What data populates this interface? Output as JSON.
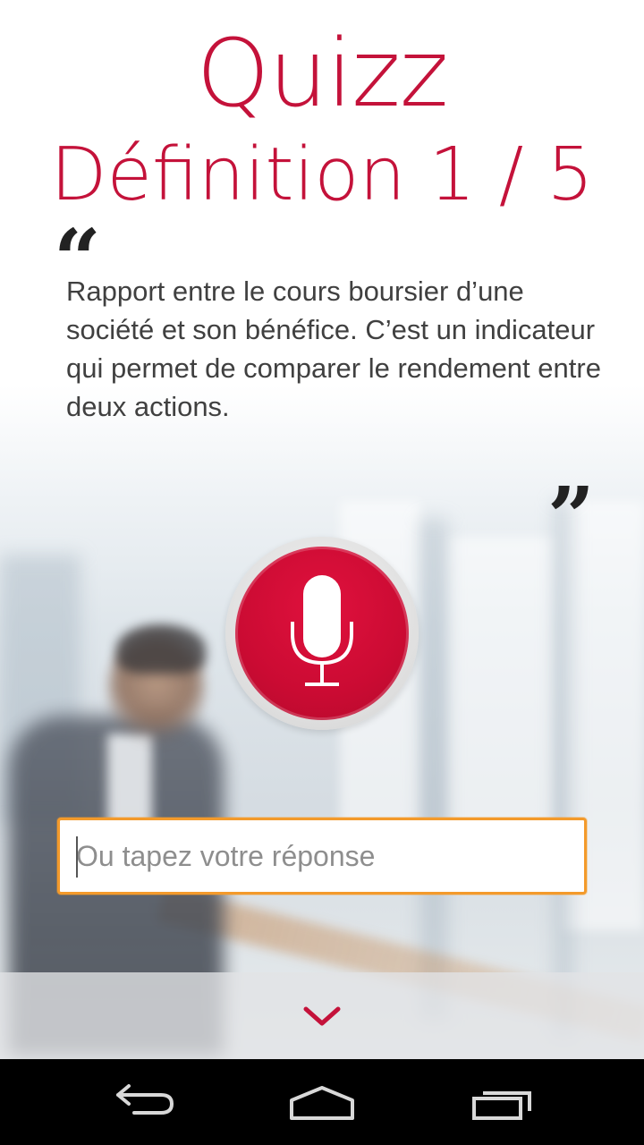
{
  "header": {
    "title": "Quizz",
    "subtitle": "Définition 1 / 5"
  },
  "definition": {
    "open_quote": "“",
    "close_quote": "”",
    "text": "Rapport entre le cours boursier d’une société et son bénéfice. C’est un indicateur qui permet de comparer le rendement entre deux actions."
  },
  "mic": {
    "icon": "microphone-icon"
  },
  "answer": {
    "placeholder": "Ou tapez votre réponse",
    "value": ""
  },
  "bottom": {
    "icon": "chevron-down-icon"
  },
  "navbar": {
    "icons": [
      "back-icon",
      "home-icon",
      "recent-apps-icon"
    ]
  },
  "colors": {
    "accent": "#c4123a",
    "input_border": "#f39a2b",
    "text": "#404040"
  }
}
